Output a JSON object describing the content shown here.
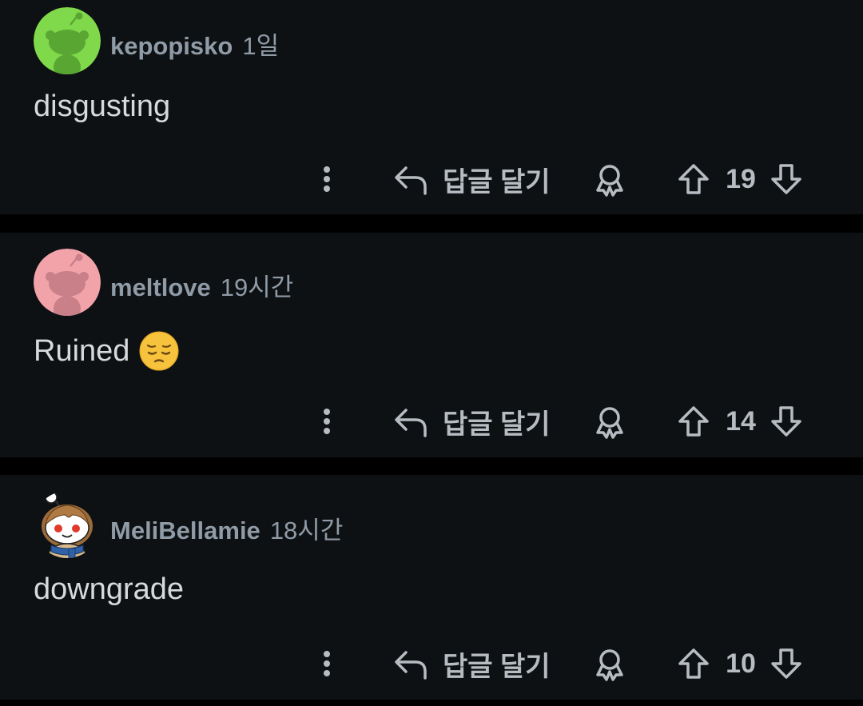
{
  "comments": [
    {
      "username": "kepopisko",
      "time": "1일",
      "body": "disgusting",
      "reply_label": "답글 달기",
      "score": "19",
      "avatar_color": "#7fd94a"
    },
    {
      "username": "meltlove",
      "time": "19시간",
      "body": "Ruined",
      "emoji": "pensive-face",
      "reply_label": "답글 달기",
      "score": "14",
      "avatar_color": "#f2a3aa"
    },
    {
      "username": "MeliBellamie",
      "time": "18시간",
      "body": "downgrade",
      "reply_label": "답글 달기",
      "score": "10",
      "avatar_color": "custom-snoo"
    }
  ],
  "colors": {
    "background": "#000000",
    "card": "#0e1114",
    "meta_text": "#8f9ba6",
    "body_text": "#d7dadc",
    "action_text": "#b6bcc1"
  },
  "icons": [
    "more-vertical-icon",
    "reply-arrow-icon",
    "award-icon",
    "upvote-arrow-icon",
    "downvote-arrow-icon"
  ]
}
